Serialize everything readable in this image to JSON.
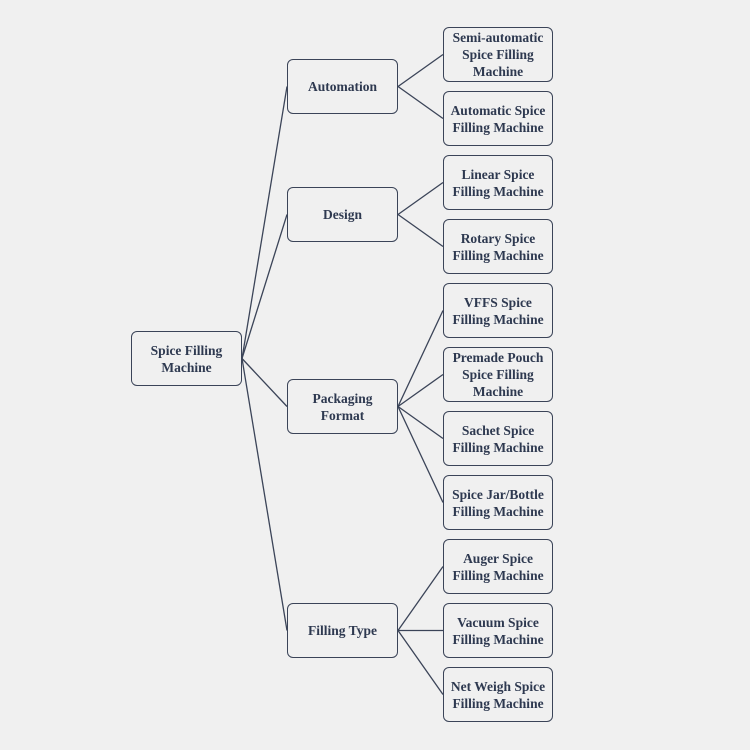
{
  "root": {
    "label": "Spice Filling Machine"
  },
  "categories": [
    {
      "label": "Automation",
      "children": [
        "Semi-automatic Spice Filling Machine",
        "Automatic Spice Filling Machine"
      ]
    },
    {
      "label": "Design",
      "children": [
        "Linear Spice Filling Machine",
        "Rotary Spice Filling Machine"
      ]
    },
    {
      "label": "Packaging Format",
      "children": [
        "VFFS Spice Filling Machine",
        "Premade Pouch Spice Filling Machine",
        "Sachet Spice Filling Machine",
        "Spice Jar/Bottle Filling Machine"
      ]
    },
    {
      "label": "Filling Type",
      "children": [
        "Auger Spice Filling Machine",
        "Vacuum Spice Filling Machine",
        "Net Weigh Spice Filling Machine"
      ]
    }
  ],
  "colors": {
    "background": "#f0f0f0",
    "border": "#3b4458",
    "text": "#2e3950"
  }
}
